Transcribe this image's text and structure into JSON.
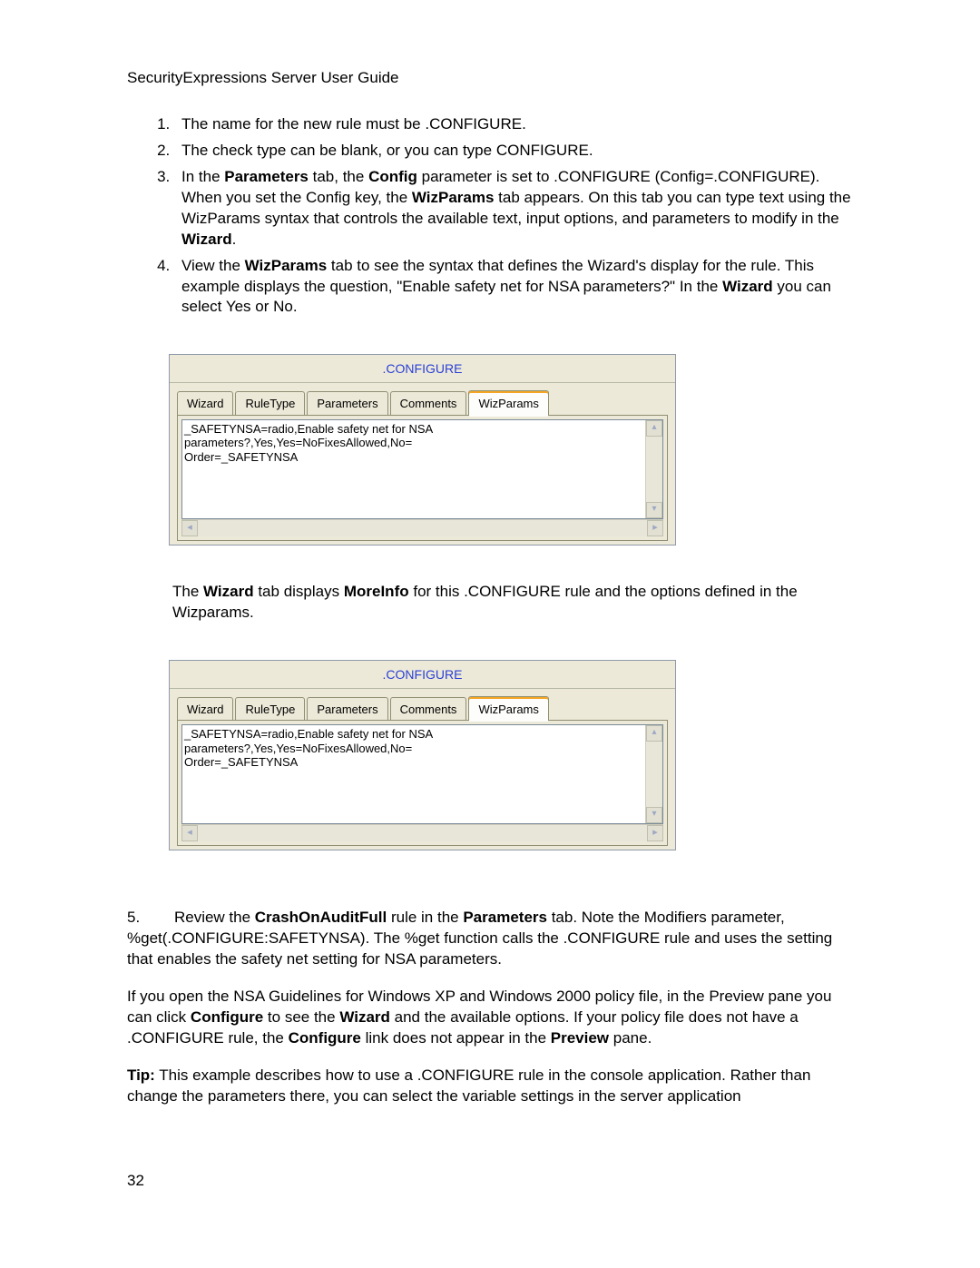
{
  "header": "SecurityExpressions Server User Guide",
  "ol": {
    "i1": "The name for the new rule must be .CONFIGURE.",
    "i2": "The check type can be blank, or you can type CONFIGURE.",
    "i3_a": "In the ",
    "i3_b": "Parameters",
    "i3_c": " tab, the ",
    "i3_d": "Config",
    "i3_e": " parameter is set to .CONFIGURE (Config=.CONFIGURE). When you set the Config key, the ",
    "i3_f": "WizParams",
    "i3_g": " tab appears. On this tab you can type text using the WizParams syntax that controls the available text, input options, and parameters to modify in the ",
    "i3_h": "Wizard",
    "i3_i": ".",
    "i4_a": "View the ",
    "i4_b": "WizParams",
    "i4_c": " tab to see the syntax that defines the Wizard's display for the rule. This example displays the question, \"Enable safety net for NSA parameters?\" In the ",
    "i4_d": "Wizard",
    "i4_e": " you can select Yes or No."
  },
  "dlg": {
    "title": ".CONFIGURE",
    "tabs": {
      "t0": "Wizard",
      "t1": "RuleType",
      "t2": "Parameters",
      "t3": "Comments",
      "t4": "WizParams"
    },
    "content_line1": "_SAFETYNSA=radio,Enable safety net for NSA parameters?,Yes,Yes=NoFixesAllowed,No=",
    "content_line2": "Order=_SAFETYNSA"
  },
  "middle_a": "The ",
  "middle_b": "Wizard",
  "middle_c": " tab displays ",
  "middle_d": "MoreInfo",
  "middle_e": " for this .CONFIGURE rule and the options defined in the Wizparams.",
  "step5_a": "5.        Review the ",
  "step5_b": "CrashOnAuditFull",
  "step5_c": " rule in the ",
  "step5_d": "Parameters",
  "step5_e": " tab. Note the Modifiers parameter, %get(.CONFIGURE:SAFETYNSA). The %get function calls the .CONFIGURE rule and uses the setting that enables the safety net setting for NSA parameters.",
  "p2_a": "If you open the NSA Guidelines for Windows XP and Windows 2000 policy file, in the Preview pane you can click ",
  "p2_b": "Configure",
  "p2_c": " to see the ",
  "p2_d": "Wizard",
  "p2_e": " and the available options. If your policy file does not have a .CONFIGURE rule, the ",
  "p2_f": "Configure",
  "p2_g": " link does not appear in the ",
  "p2_h": "Preview",
  "p2_i": " pane.",
  "tip_a": "Tip:",
  "tip_b": " This example describes how to use a .CONFIGURE rule in the console application. Rather than change the parameters there, you can select the variable settings in the server application",
  "page_num": "32"
}
